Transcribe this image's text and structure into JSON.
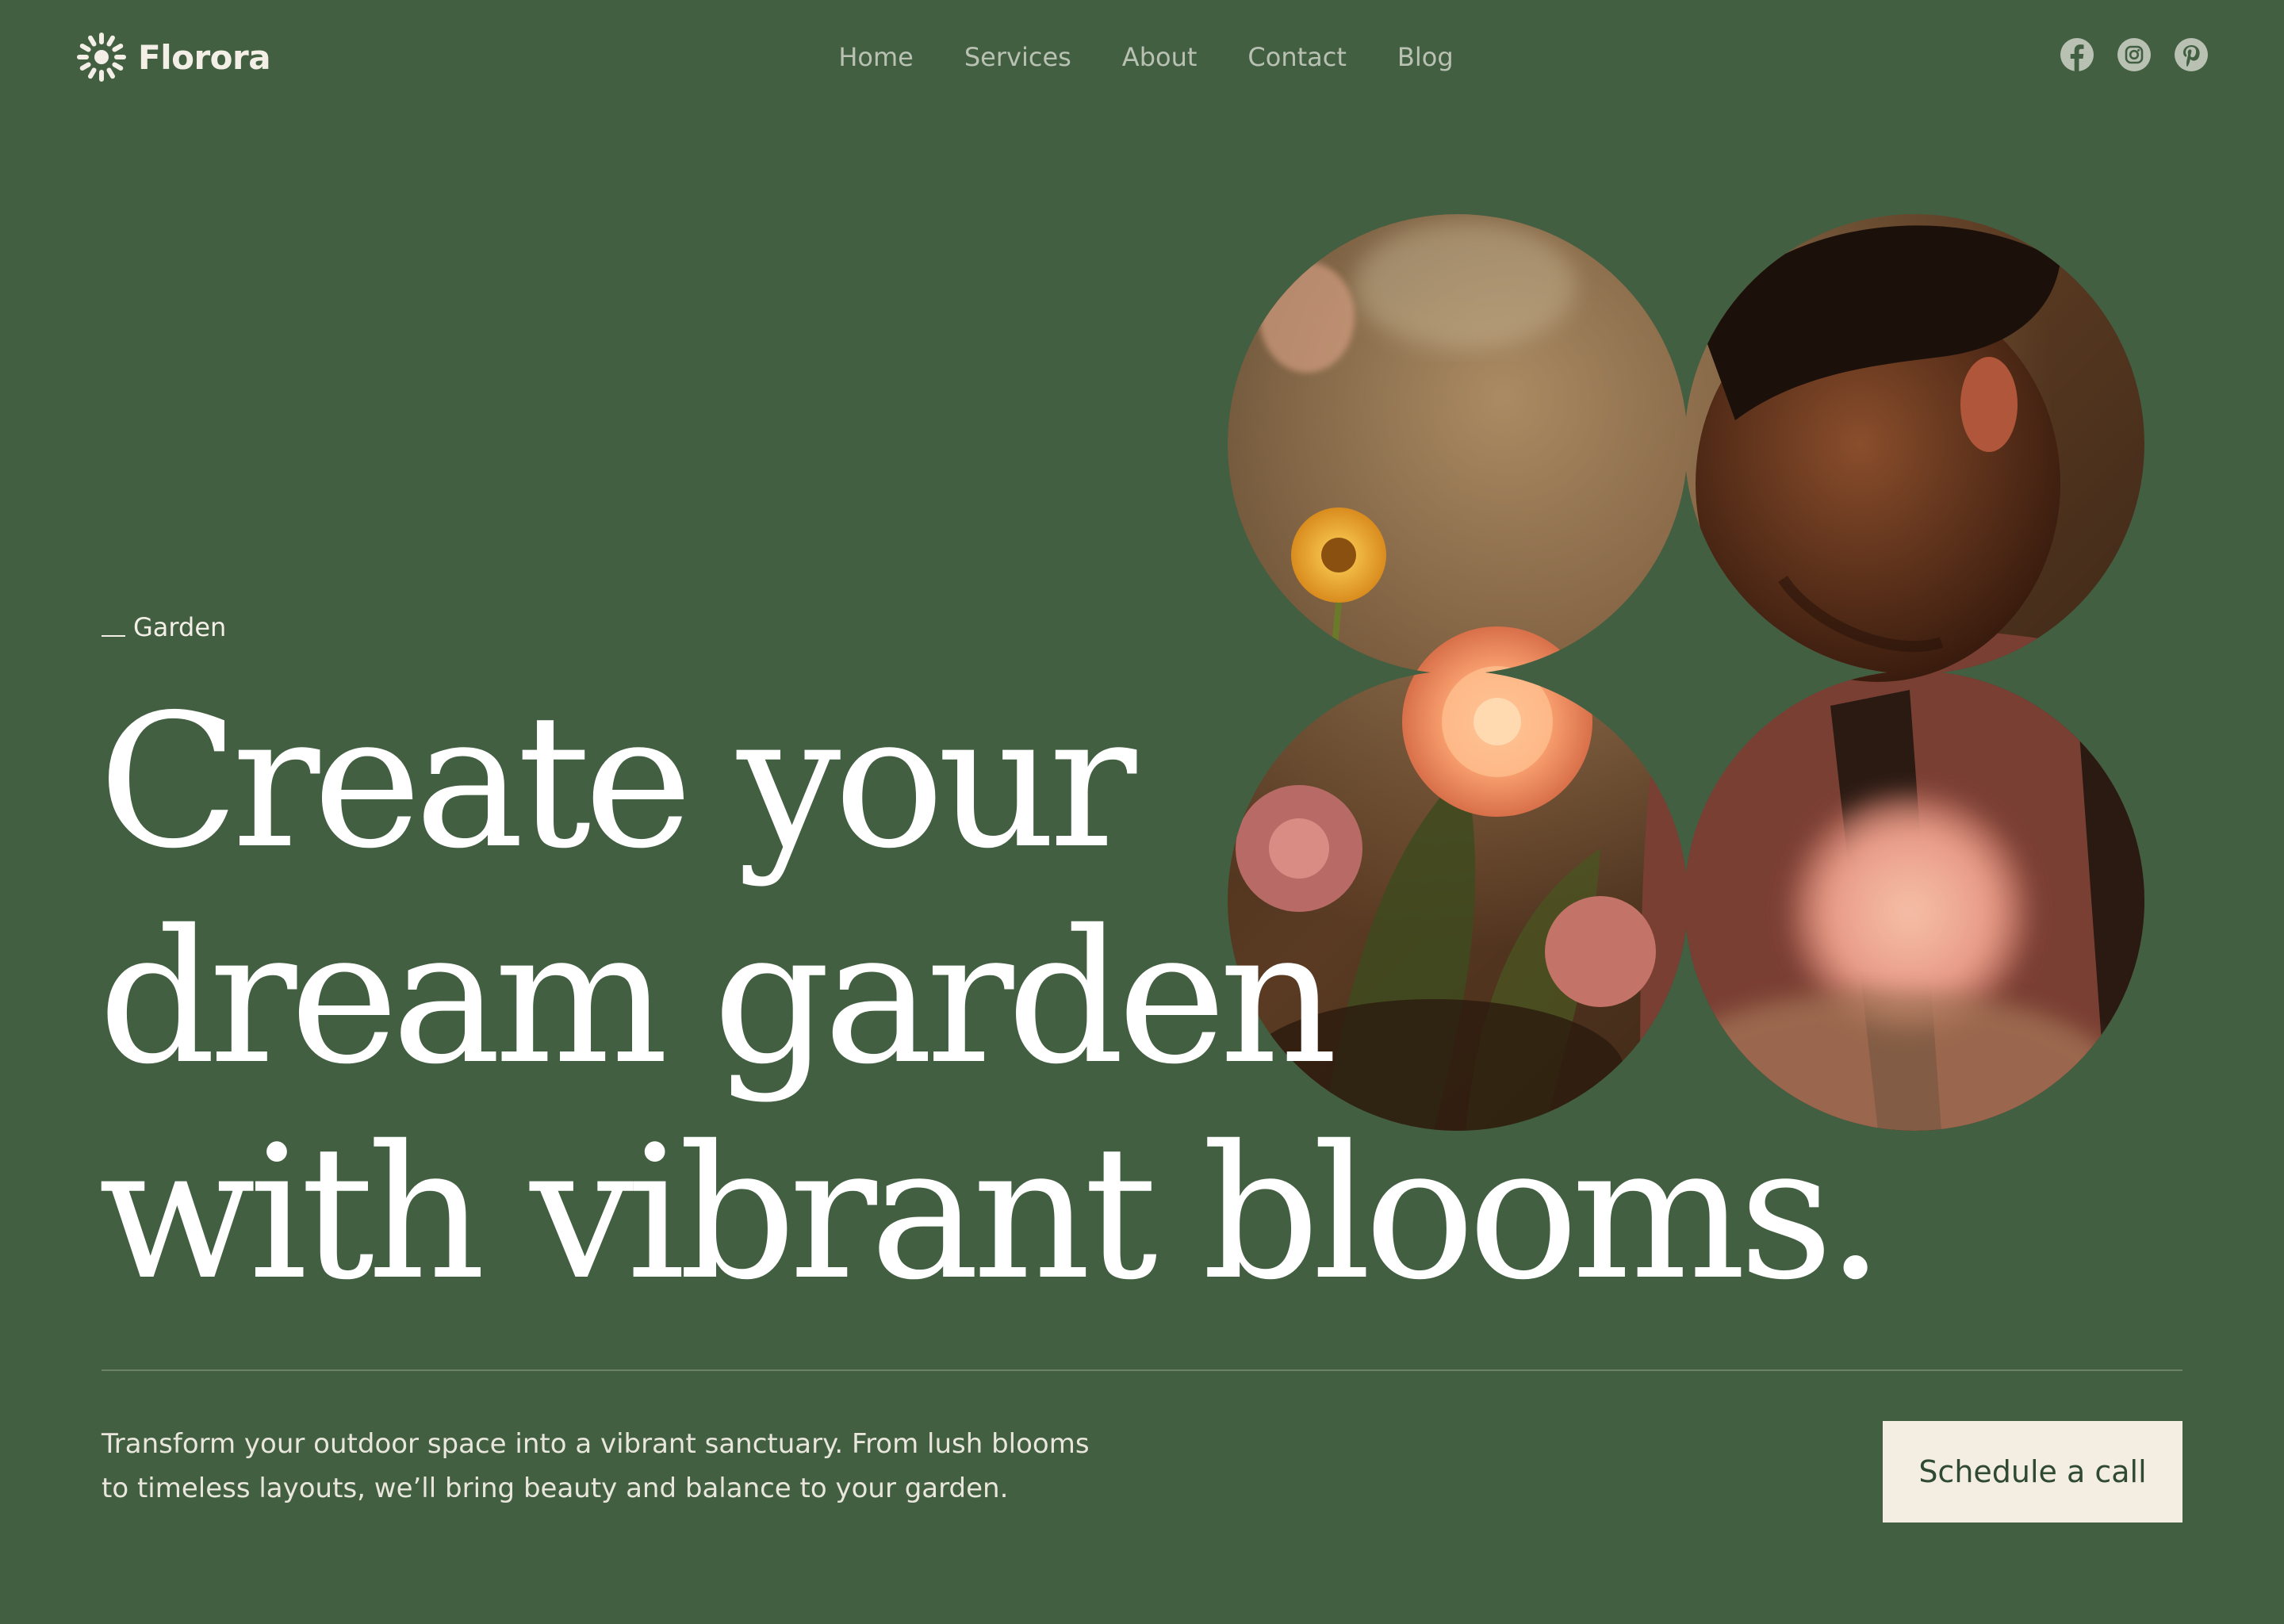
{
  "brand": {
    "name": "Florora",
    "icon": "sunburst-logo-icon"
  },
  "nav": {
    "items": [
      {
        "label": "Home"
      },
      {
        "label": "Services"
      },
      {
        "label": "About"
      },
      {
        "label": "Contact"
      },
      {
        "label": "Blog"
      }
    ]
  },
  "social": {
    "icons": [
      "facebook-icon",
      "instagram-icon",
      "pinterest-icon"
    ]
  },
  "hero": {
    "eyebrow": "Garden",
    "headline": [
      "Create your",
      "dream garden",
      "with vibrant blooms."
    ],
    "description": [
      "Transform your outdoor space into a vibrant sanctuary. From lush blooms",
      "to timeless layouts, we’ll bring beauty and balance to your garden."
    ],
    "cta_label": "Schedule a call",
    "image_subject": "gardener tending orange and pink flowers, cropped in a four-circle clover shape"
  },
  "colors": {
    "background": "#425f42",
    "text_primary": "#ffffff",
    "nav_text": "#b9c1b3",
    "cta_background": "#f3ede2",
    "cta_text": "#2f4a30",
    "divider": "#6c8266"
  }
}
